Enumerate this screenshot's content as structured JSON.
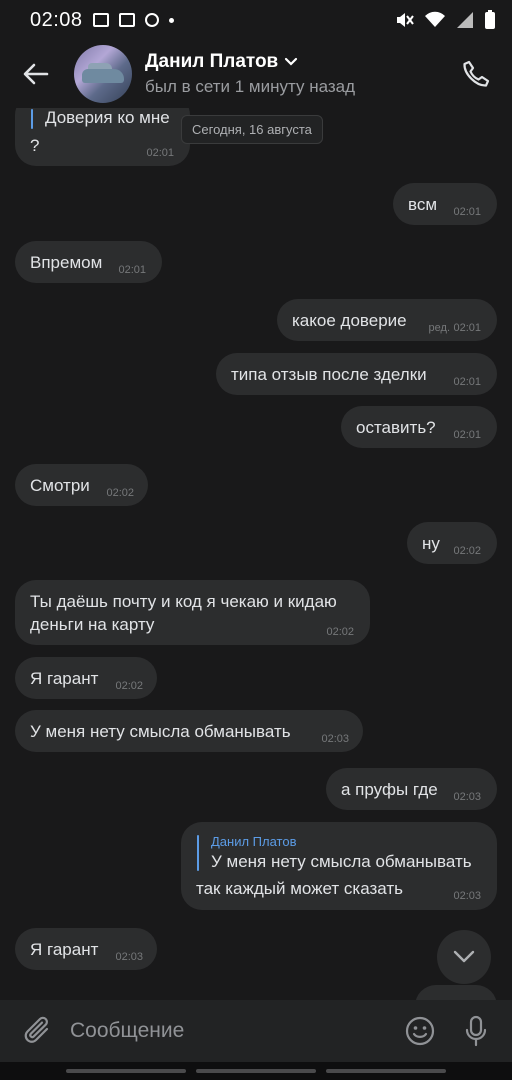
{
  "status_bar": {
    "time": "02:08"
  },
  "header": {
    "name": "Данил Платов",
    "status": "был в сети 1 минуту назад"
  },
  "date_separator": "Сегодня, 16 августа",
  "messages": [
    {
      "side": "in",
      "reply_text": "Доверия ко мне",
      "text": "?",
      "time": "02:01"
    },
    {
      "side": "out",
      "text": "всм",
      "time": "02:01"
    },
    {
      "side": "in",
      "text": "Впремом",
      "time": "02:01"
    },
    {
      "side": "out",
      "text": "какое доверие",
      "edited": "ред.",
      "time": "02:01"
    },
    {
      "side": "out",
      "text": "типа отзыв после зделки",
      "time": "02:01"
    },
    {
      "side": "out",
      "text": "оставить?",
      "time": "02:01"
    },
    {
      "side": "in",
      "text": "Смотри",
      "time": "02:02"
    },
    {
      "side": "out",
      "text": "ну",
      "time": "02:02"
    },
    {
      "side": "in",
      "lines": [
        "Ты даёшь почту и код я чекаю и кидаю",
        "деньги на карту"
      ],
      "time": "02:02"
    },
    {
      "side": "in",
      "text": "Я гарант",
      "time": "02:02"
    },
    {
      "side": "in",
      "text": "У меня нету смысла обманывать",
      "time": "02:03"
    },
    {
      "side": "out",
      "text": "а пруфы где",
      "time": "02:03"
    },
    {
      "side": "out",
      "reply_author": "Данил Платов",
      "reply_text": "У меня нету смысла обманывать",
      "text": "так каждый может сказать",
      "time": "02:03"
    },
    {
      "side": "in",
      "text": "Я гарант",
      "time": "02:03"
    }
  ],
  "composer": {
    "placeholder": "Сообщение"
  }
}
